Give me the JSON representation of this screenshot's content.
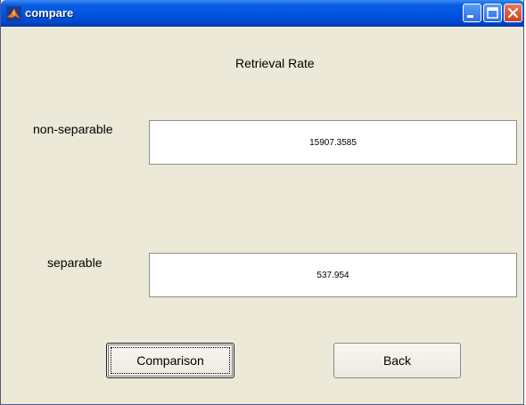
{
  "window": {
    "title": "compare"
  },
  "heading": "Retrieval Rate",
  "rows": [
    {
      "label": "non-separable",
      "value": "15907.3585"
    },
    {
      "label": "separable",
      "value": "537.954"
    }
  ],
  "buttons": {
    "comparison_label": "Comparison",
    "back_label": "Back"
  },
  "icons": {
    "app": "matlab-icon",
    "minimize": "minimize-icon",
    "maximize": "maximize-icon",
    "close": "close-icon"
  },
  "colors": {
    "window_bg": "#ECE9D8",
    "titlebar": "#0054E3",
    "close_button": "#C8401F"
  }
}
